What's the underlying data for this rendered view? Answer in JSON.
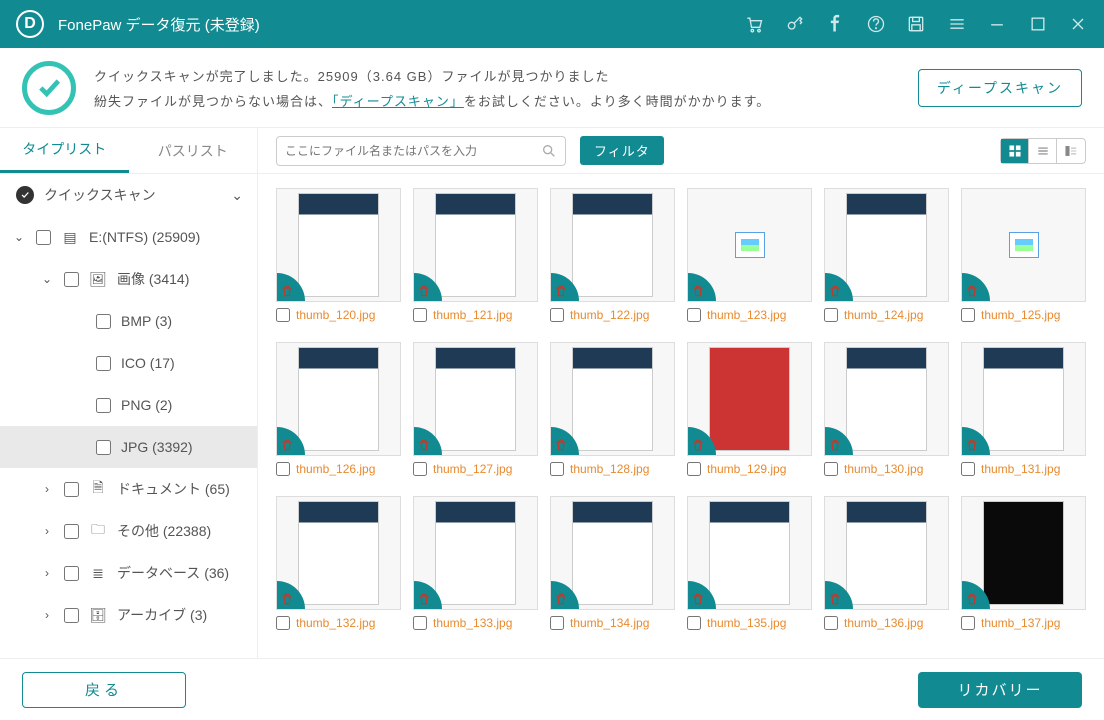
{
  "titlebar": {
    "title": "FonePaw データ復元 (未登録)"
  },
  "status": {
    "line1": "クイックスキャンが完了しました。25909（3.64 GB）ファイルが見つかりました",
    "line2_pre": "紛失ファイルが見つからない場合は、",
    "line2_link": "「ディープスキャン」",
    "line2_post": "をお試しください。より多く時間がかかります。",
    "deep_btn": "ディープスキャン"
  },
  "tabs": {
    "types": "タイプリスト",
    "paths": "パスリスト"
  },
  "tree": {
    "header": "クイックスキャン",
    "drive": "E:(NTFS) (25909)",
    "images": "画像 (3414)",
    "bmp": "BMP (3)",
    "ico": "ICO (17)",
    "png": "PNG (2)",
    "jpg": "JPG (3392)",
    "docs": "ドキュメント (65)",
    "other": "その他 (22388)",
    "db": "データベース (36)",
    "archive": "アーカイブ (3)"
  },
  "toolbar": {
    "search_placeholder": "ここにファイル名またはパスを入力",
    "filter": "フィルタ"
  },
  "thumbs": [
    {
      "name": "thumb_120.jpg",
      "mock": "app"
    },
    {
      "name": "thumb_121.jpg",
      "mock": "app"
    },
    {
      "name": "thumb_122.jpg",
      "mock": "app"
    },
    {
      "name": "thumb_123.jpg",
      "mock": "icon"
    },
    {
      "name": "thumb_124.jpg",
      "mock": "app"
    },
    {
      "name": "thumb_125.jpg",
      "mock": "icon"
    },
    {
      "name": "thumb_126.jpg",
      "mock": "app"
    },
    {
      "name": "thumb_127.jpg",
      "mock": "app"
    },
    {
      "name": "thumb_128.jpg",
      "mock": "app"
    },
    {
      "name": "thumb_129.jpg",
      "mock": "red"
    },
    {
      "name": "thumb_130.jpg",
      "mock": "app"
    },
    {
      "name": "thumb_131.jpg",
      "mock": "app"
    },
    {
      "name": "thumb_132.jpg",
      "mock": "app"
    },
    {
      "name": "thumb_133.jpg",
      "mock": "app"
    },
    {
      "name": "thumb_134.jpg",
      "mock": "app"
    },
    {
      "name": "thumb_135.jpg",
      "mock": "app"
    },
    {
      "name": "thumb_136.jpg",
      "mock": "app"
    },
    {
      "name": "thumb_137.jpg",
      "mock": "dark"
    }
  ],
  "footer": {
    "back": "戻る",
    "recover": "リカバリー"
  }
}
